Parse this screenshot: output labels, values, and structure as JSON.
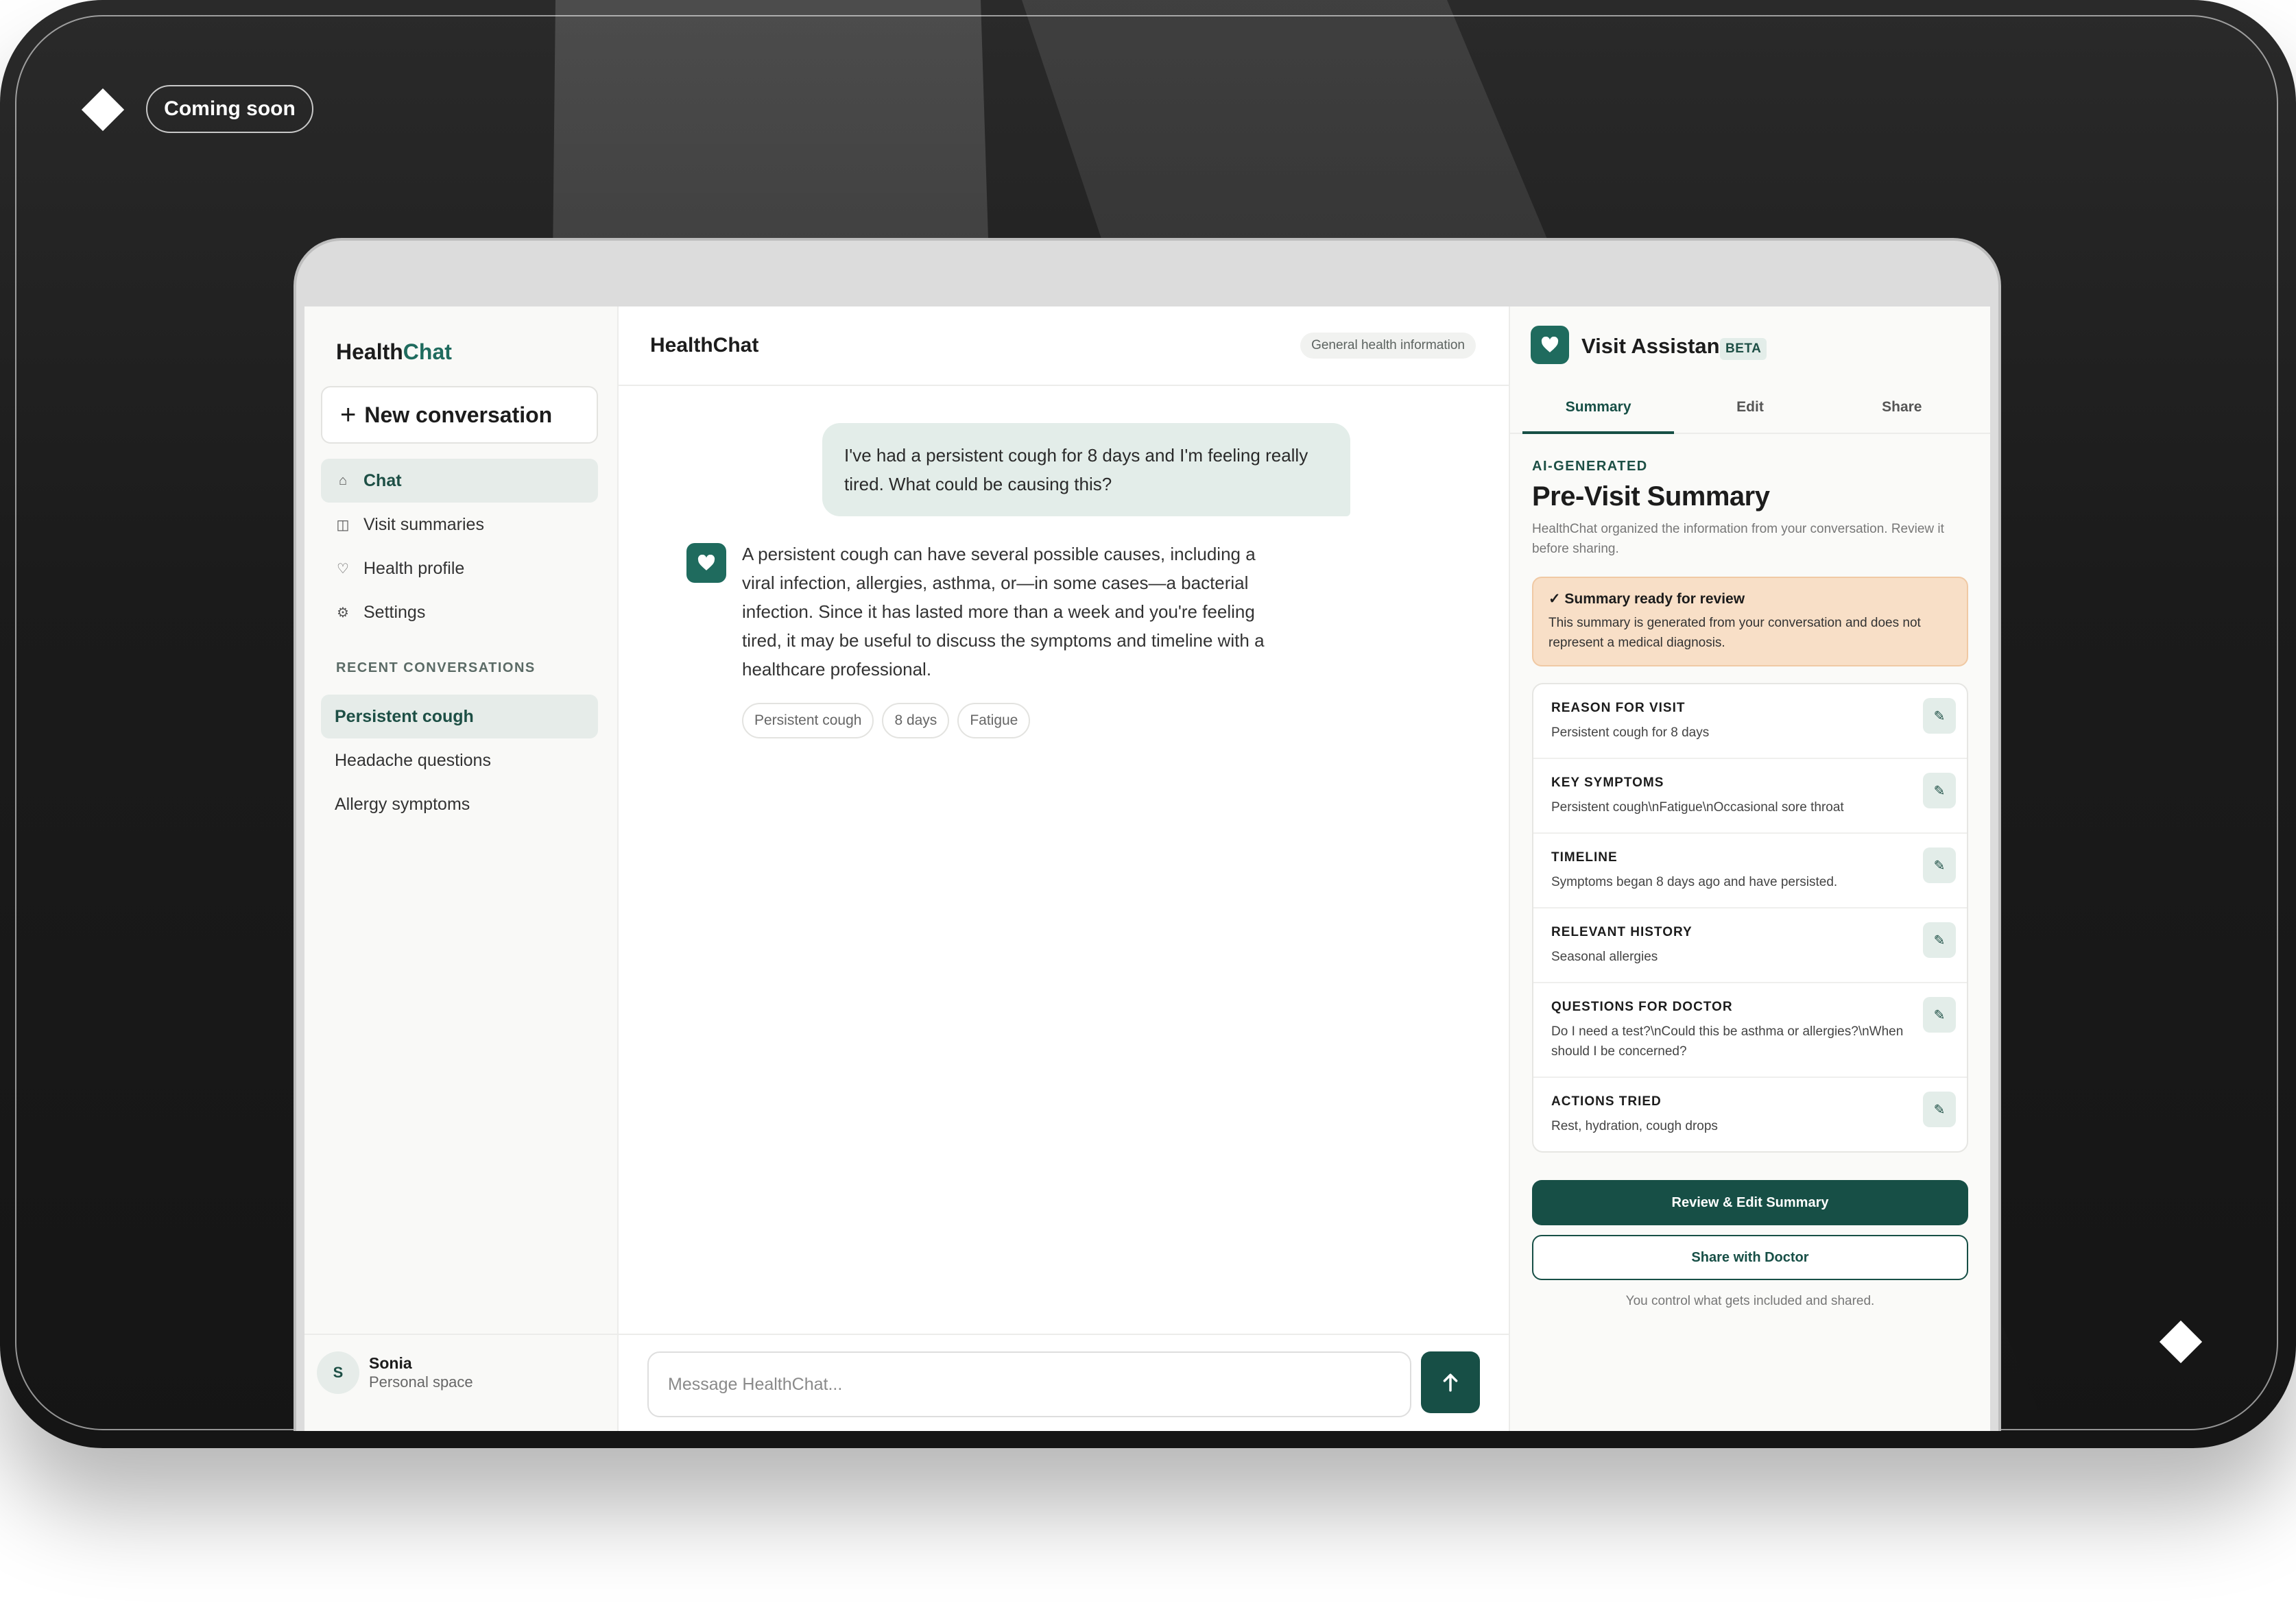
{
  "badge": {
    "label": "Coming soon"
  },
  "sidebar": {
    "logo_part1": "Health",
    "logo_part2": "Chat",
    "new_conversation": "New conversation",
    "nav": [
      {
        "label": "Chat",
        "icon": "home-icon"
      },
      {
        "label": "Visit summaries",
        "icon": "document-icon"
      },
      {
        "label": "Health profile",
        "icon": "heart-icon"
      },
      {
        "label": "Settings",
        "icon": "gear-icon"
      }
    ],
    "recent_label": "RECENT CONVERSATIONS",
    "recent": [
      {
        "label": "Persistent cough"
      },
      {
        "label": "Headache questions"
      },
      {
        "label": "Allergy symptoms"
      }
    ],
    "user": {
      "initial": "S",
      "name": "Sonia",
      "subtitle": "Personal space"
    }
  },
  "chat": {
    "title": "HealthChat",
    "badge": "General health information",
    "user_message": "I've had a persistent cough for 8 days and I'm feeling really tired. What could be causing this?",
    "assistant_message": "A persistent cough can have several possible causes, including a viral infection, allergies, asthma, or—in some cases—a bacterial infection. Since it has lasted more than a week and you're feeling tired, it may be useful to discuss the symptoms and timeline with a healthcare professional.",
    "tags": [
      "Persistent cough",
      "8 days",
      "Fatigue"
    ],
    "input_placeholder": "Message HealthChat..."
  },
  "panel": {
    "title": "Visit Assistant",
    "beta": "BETA",
    "tabs": [
      "Summary",
      "Edit",
      "Share"
    ],
    "active_tab": "Summary",
    "tag": "AI-GENERATED",
    "heading": "Pre-Visit Summary",
    "subtitle": "HealthChat organized the information from your conversation. Review it before sharing.",
    "ready_title": "✓ Summary ready for review",
    "ready_text": "This summary is generated from your conversation and does not represent a medical diagnosis.",
    "sections": [
      {
        "title": "REASON FOR VISIT",
        "value": "Persistent cough for 8 days"
      },
      {
        "title": "KEY SYMPTOMS",
        "value": "Persistent cough\\nFatigue\\nOccasional sore throat"
      },
      {
        "title": "TIMELINE",
        "value": "Symptoms began 8 days ago and have persisted."
      },
      {
        "title": "RELEVANT HISTORY",
        "value": "Seasonal allergies"
      },
      {
        "title": "QUESTIONS FOR DOCTOR",
        "value": "Do I need a test?\\nCould this be asthma or allergies?\\nWhen should I be concerned?"
      },
      {
        "title": "ACTIONS TRIED",
        "value": "Rest, hydration, cough drops"
      }
    ],
    "primary_button": "Review & Edit Summary",
    "secondary_button": "Share with Doctor",
    "footnote": "You control what gets included and shared."
  },
  "colors": {
    "accent": "#1f6b5e",
    "accent_dark": "#174f46",
    "accent_light": "#e3ede9",
    "notice_bg": "#f8dfc7"
  }
}
